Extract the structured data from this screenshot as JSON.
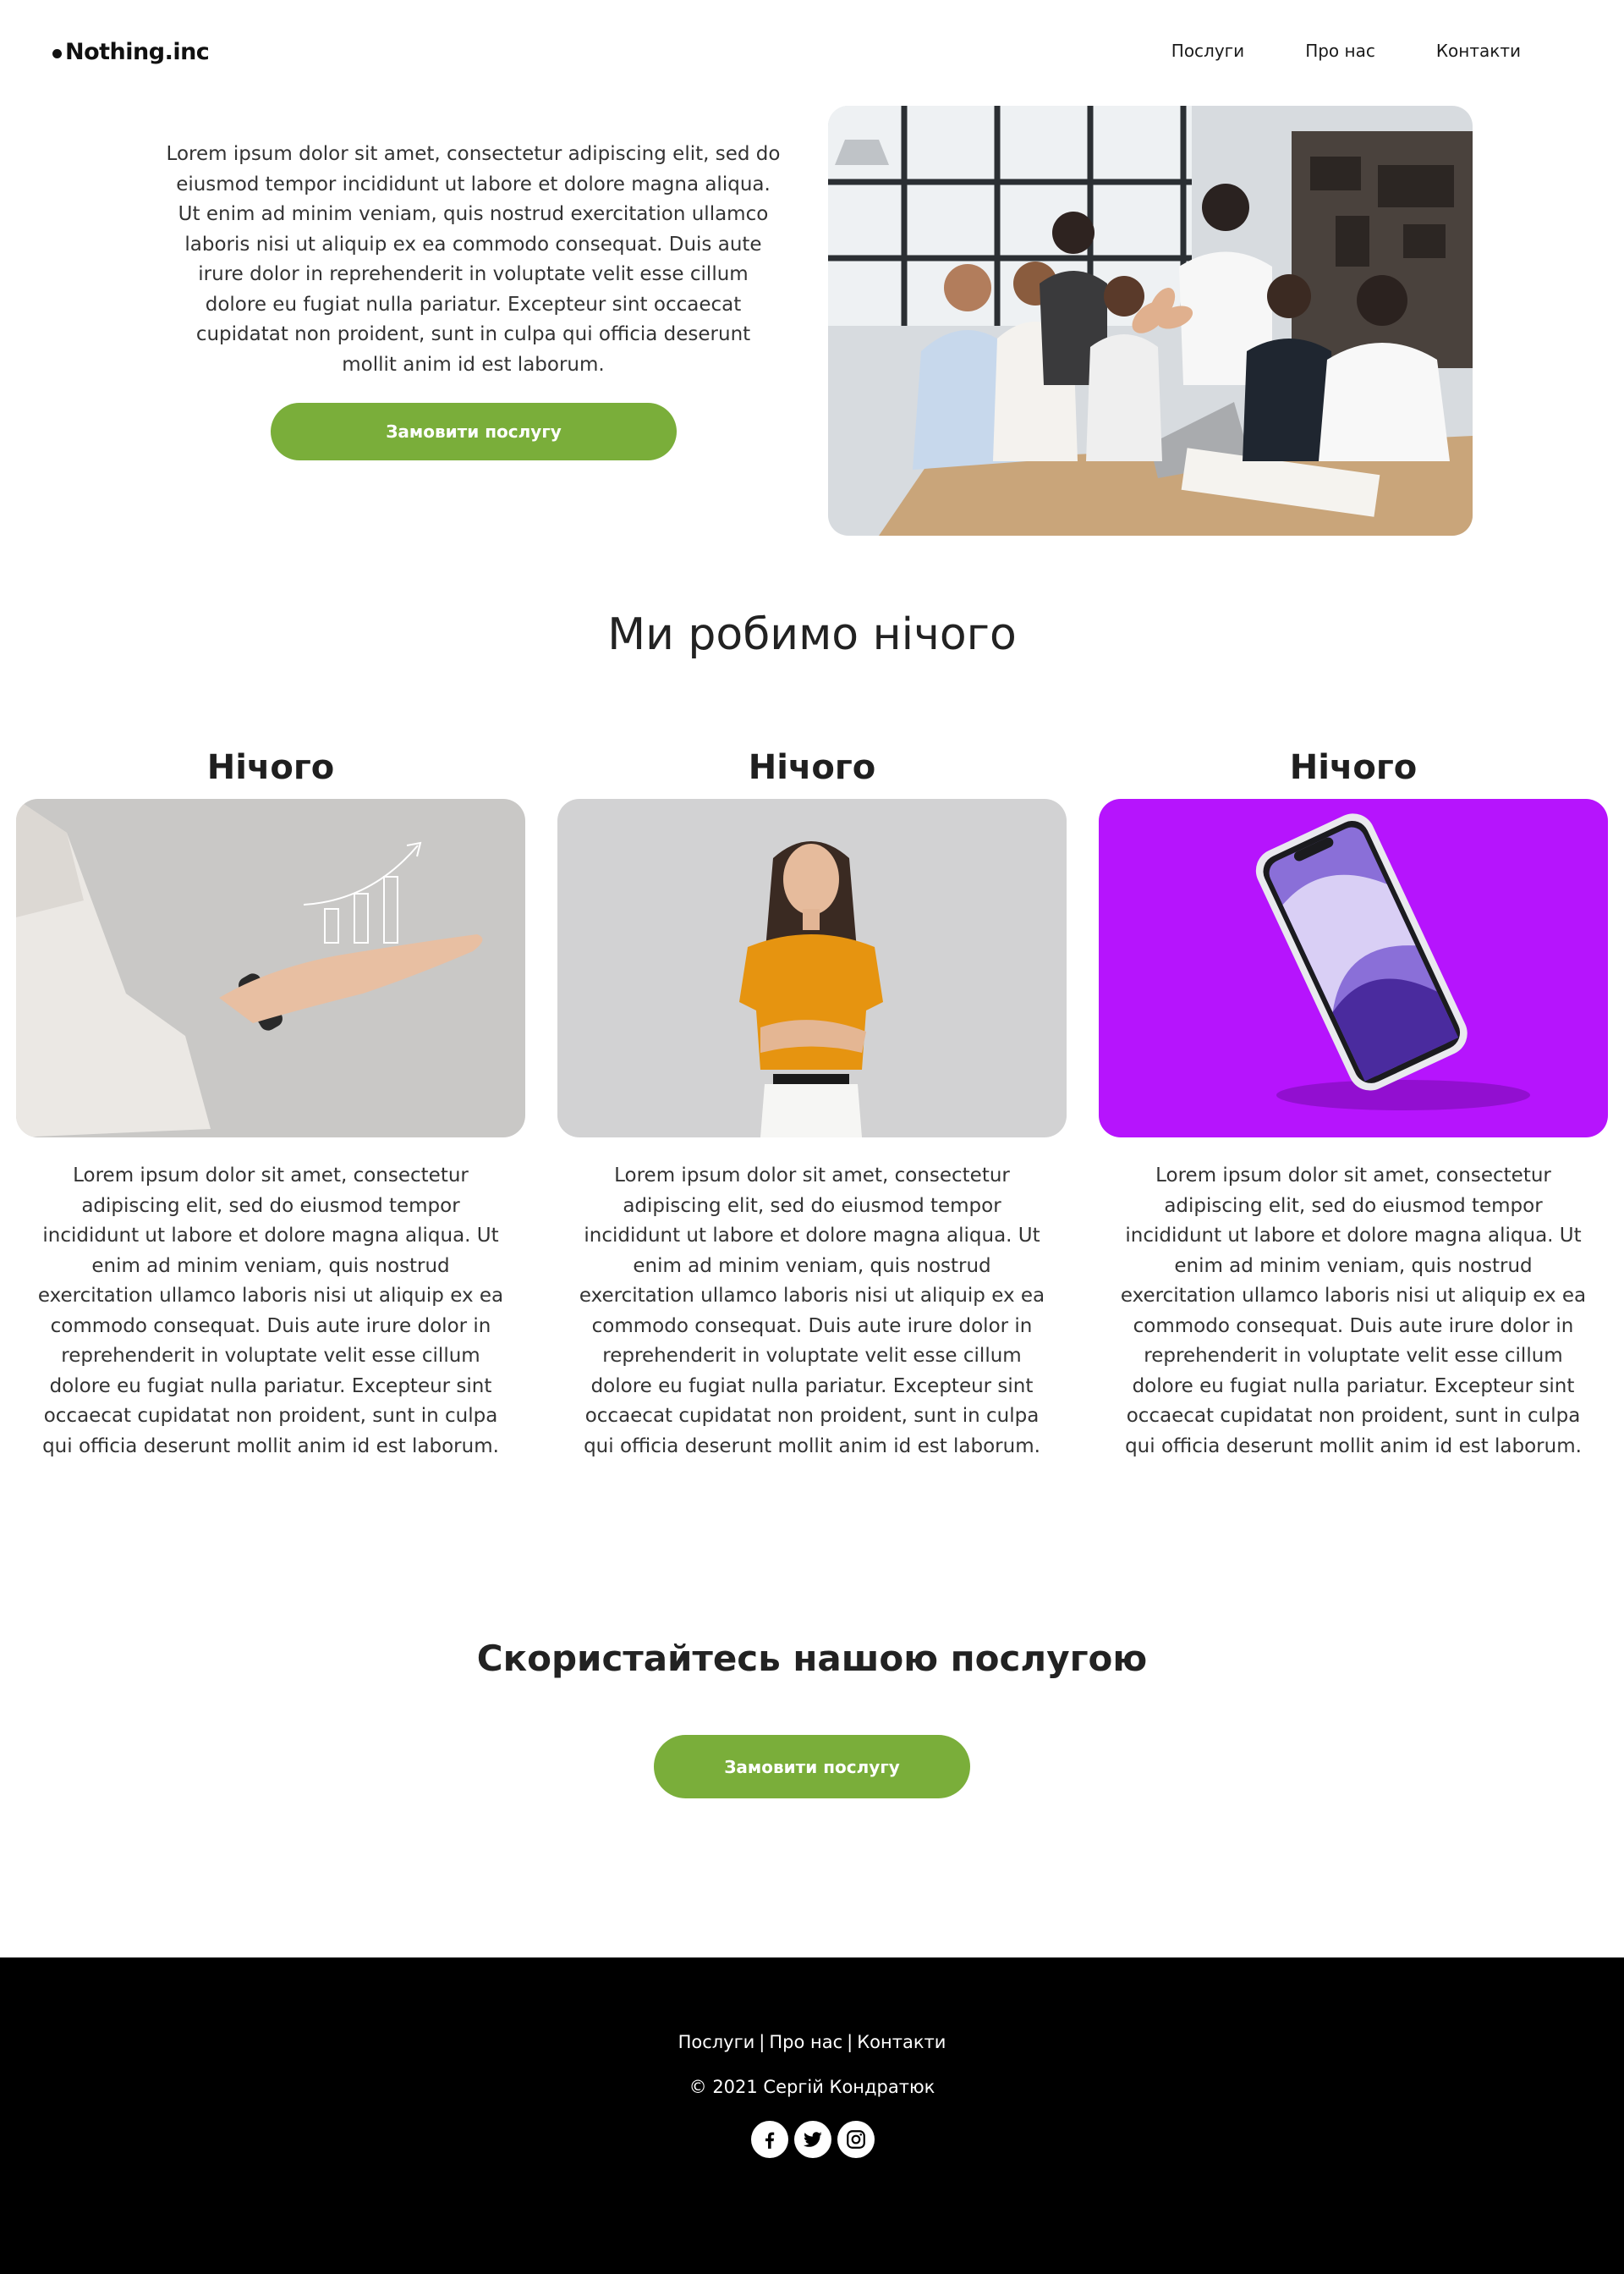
{
  "header": {
    "logo": "Nothing.inc",
    "nav": [
      "Послуги",
      "Про нас",
      "Контакти"
    ]
  },
  "hero": {
    "text": "Lorem ipsum dolor sit amet, consectetur adipiscing elit, sed do eiusmod tempor incididunt ut labore et dolore magna aliqua. Ut enim ad minim veniam, quis nostrud exercitation ullamco laboris nisi ut aliquip ex ea commodo consequat. Duis aute irure dolor in reprehenderit in voluptate velit esse cillum dolore eu fugiat nulla pariatur. Excepteur sint occaecat cupidatat non proident, sunt in culpa qui officia deserunt mollit anim id est laborum.",
    "button": "Замовити послугу",
    "image": "team-high-five-photo"
  },
  "section": {
    "title": "Ми робимо нічого"
  },
  "cards": [
    {
      "title": "Нічого",
      "image": "hand-growth-chart-photo",
      "text": "Lorem ipsum dolor sit amet, consectetur adipiscing elit, sed do eiusmod tempor incididunt ut labore et dolore magna aliqua. Ut enim ad minim veniam, quis nostrud exercitation ullamco laboris nisi ut aliquip ex ea commodo consequat. Duis aute irure dolor in reprehenderit in voluptate velit esse cillum dolore eu fugiat nulla pariatur. Excepteur sint occaecat cupidatat non proident, sunt in culpa qui officia deserunt mollit anim id est laborum."
    },
    {
      "title": "Нічого",
      "image": "woman-orange-shirt-photo",
      "text": "Lorem ipsum dolor sit amet, consectetur adipiscing elit, sed do eiusmod tempor incididunt ut labore et dolore magna aliqua. Ut enim ad minim veniam, quis nostrud exercitation ullamco laboris nisi ut aliquip ex ea commodo consequat. Duis aute irure dolor in reprehenderit in voluptate velit esse cillum dolore eu fugiat nulla pariatur. Excepteur sint occaecat cupidatat non proident, sunt in culpa qui officia deserunt mollit anim id est laborum."
    },
    {
      "title": "Нічого",
      "image": "smartphone-purple-photo",
      "text": "Lorem ipsum dolor sit amet, consectetur adipiscing elit, sed do eiusmod tempor incididunt ut labore et dolore magna aliqua. Ut enim ad minim veniam, quis nostrud exercitation ullamco laboris nisi ut aliquip ex ea commodo consequat. Duis aute irure dolor in reprehenderit in voluptate velit esse cillum dolore eu fugiat nulla pariatur. Excepteur sint occaecat cupidatat non proident, sunt in culpa qui officia deserunt mollit anim id est laborum."
    }
  ],
  "cta": {
    "title": "Скористайтесь нашою послугою",
    "button": "Замовити послугу"
  },
  "footer": {
    "links": [
      "Послуги",
      "Про нас",
      "Контакти"
    ],
    "separator": "|",
    "copyright": "© 2021 Сергій Кондратюк",
    "socials": [
      "facebook-icon",
      "twitter-icon",
      "instagram-icon"
    ]
  },
  "colors": {
    "accent": "#7aae3a",
    "footer_bg": "#000000",
    "phone_bg": "#b414ff"
  }
}
